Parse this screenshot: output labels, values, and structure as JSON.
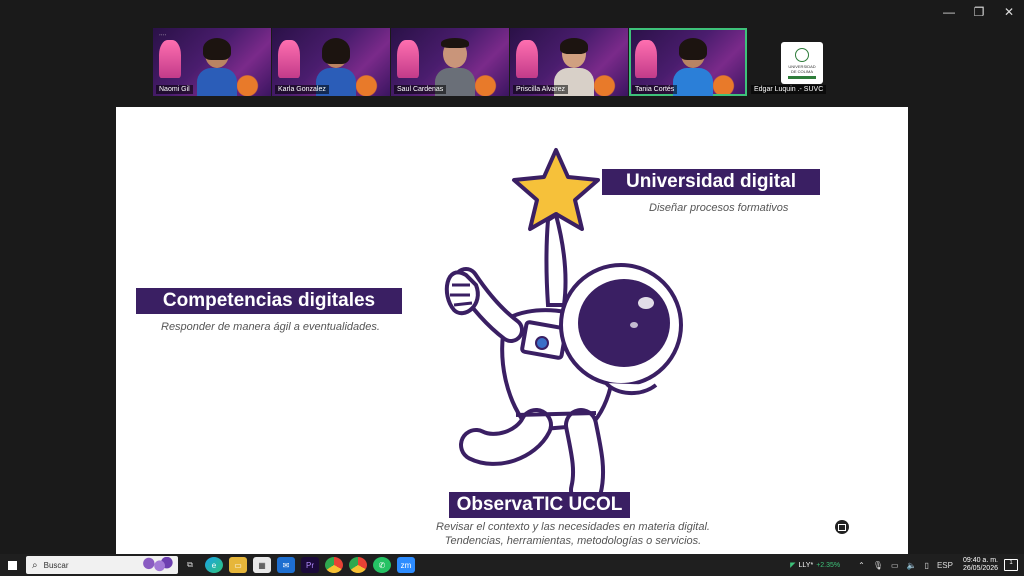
{
  "window": {
    "minimize": "—",
    "restore": "❐",
    "close": "✕"
  },
  "participants": [
    {
      "name": "Naomi Gil",
      "shirt": "#2b5db8",
      "skin": "#b98463"
    },
    {
      "name": "Karla Gonzalez",
      "shirt": "#2b5db8",
      "skin": "#c48a67"
    },
    {
      "name": "Saul Cardenas",
      "shirt": "#6a6f78",
      "skin": "#c9957a"
    },
    {
      "name": "Priscilla Alvarez",
      "shirt": "#d8d0c8",
      "skin": "#d0a080"
    },
    {
      "name": "Tania Cortés",
      "shirt": "#2b7fd8",
      "skin": "#b78462"
    }
  ],
  "logo_tile": {
    "name": "Edgar Luquin .- SUVC",
    "logo_line1": "UNIVERSIDAD",
    "logo_line2": "DE COLIMA"
  },
  "slide": {
    "universidad_title": "Universidad digital",
    "universidad_caption": "Diseñar procesos formativos",
    "competencias_title": "Competencias digitales",
    "competencias_caption": "Responder de manera ágil a eventualidades.",
    "observa_title": "ObservaTIC UCOL",
    "observa_caption_1": "Revisar el contexto y las necesidades en materia digital.",
    "observa_caption_2": "Tendencias, herramientas, metodologías o servicios."
  },
  "taskbar": {
    "search_placeholder": "Buscar",
    "apps": [
      "task-view",
      "edge",
      "file-explorer",
      "calendar",
      "outlook",
      "premiere",
      "chrome",
      "chrome-alt",
      "whatsapp",
      "zoom"
    ],
    "stock_symbol": "LLY*",
    "stock_change": "+2.35%",
    "language": "ESP",
    "time": "09:40 a. m.",
    "date": "26/05/2026",
    "notifications": "1"
  },
  "colors": {
    "accent": "#3a1f63",
    "star": "#f6c13a",
    "active_border": "#3ec27a"
  }
}
